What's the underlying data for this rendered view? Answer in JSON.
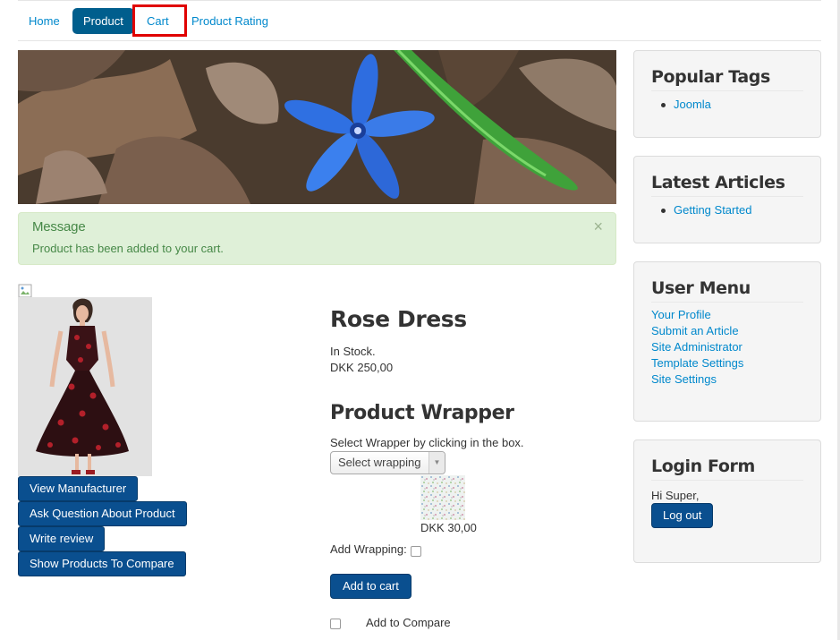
{
  "nav": {
    "items": [
      "Home",
      "Product",
      "Cart",
      "Product Rating"
    ],
    "active": "Product",
    "highlighted": "Cart"
  },
  "alert": {
    "heading": "Message",
    "text": "Product has been added to your cart.",
    "close": "×"
  },
  "product": {
    "name": "Rose Dress",
    "stock": "In Stock.",
    "price": "DKK 250,00",
    "actions": [
      "View Manufacturer",
      "Ask Question About Product",
      "Write review",
      "Show Products To Compare"
    ]
  },
  "wrapper": {
    "title": "Product Wrapper",
    "help": "Select Wrapper by clicking in the box.",
    "select_value": "Select wrapping",
    "option_price": "DKK 30,00",
    "add_label": "Add Wrapping:",
    "add_to_cart": "Add to cart",
    "compare_label": "Add to Compare"
  },
  "sidebar": {
    "popular_tags": {
      "title": "Popular Tags",
      "items": [
        "Joomla"
      ]
    },
    "latest_articles": {
      "title": "Latest Articles",
      "items": [
        "Getting Started"
      ]
    },
    "user_menu": {
      "title": "User Menu",
      "items": [
        "Your Profile",
        "Submit an Article",
        "Site Administrator",
        "Template Settings",
        "Site Settings"
      ]
    },
    "login_form": {
      "title": "Login Form",
      "greeting": "Hi Super,",
      "logout": "Log out"
    }
  },
  "colors": {
    "link": "#0088cc",
    "primary_button": "#0a4f8f",
    "nav_active": "#005e8d",
    "alert_bg": "#dff0d8",
    "alert_text": "#468847",
    "highlight": "#e00000"
  }
}
